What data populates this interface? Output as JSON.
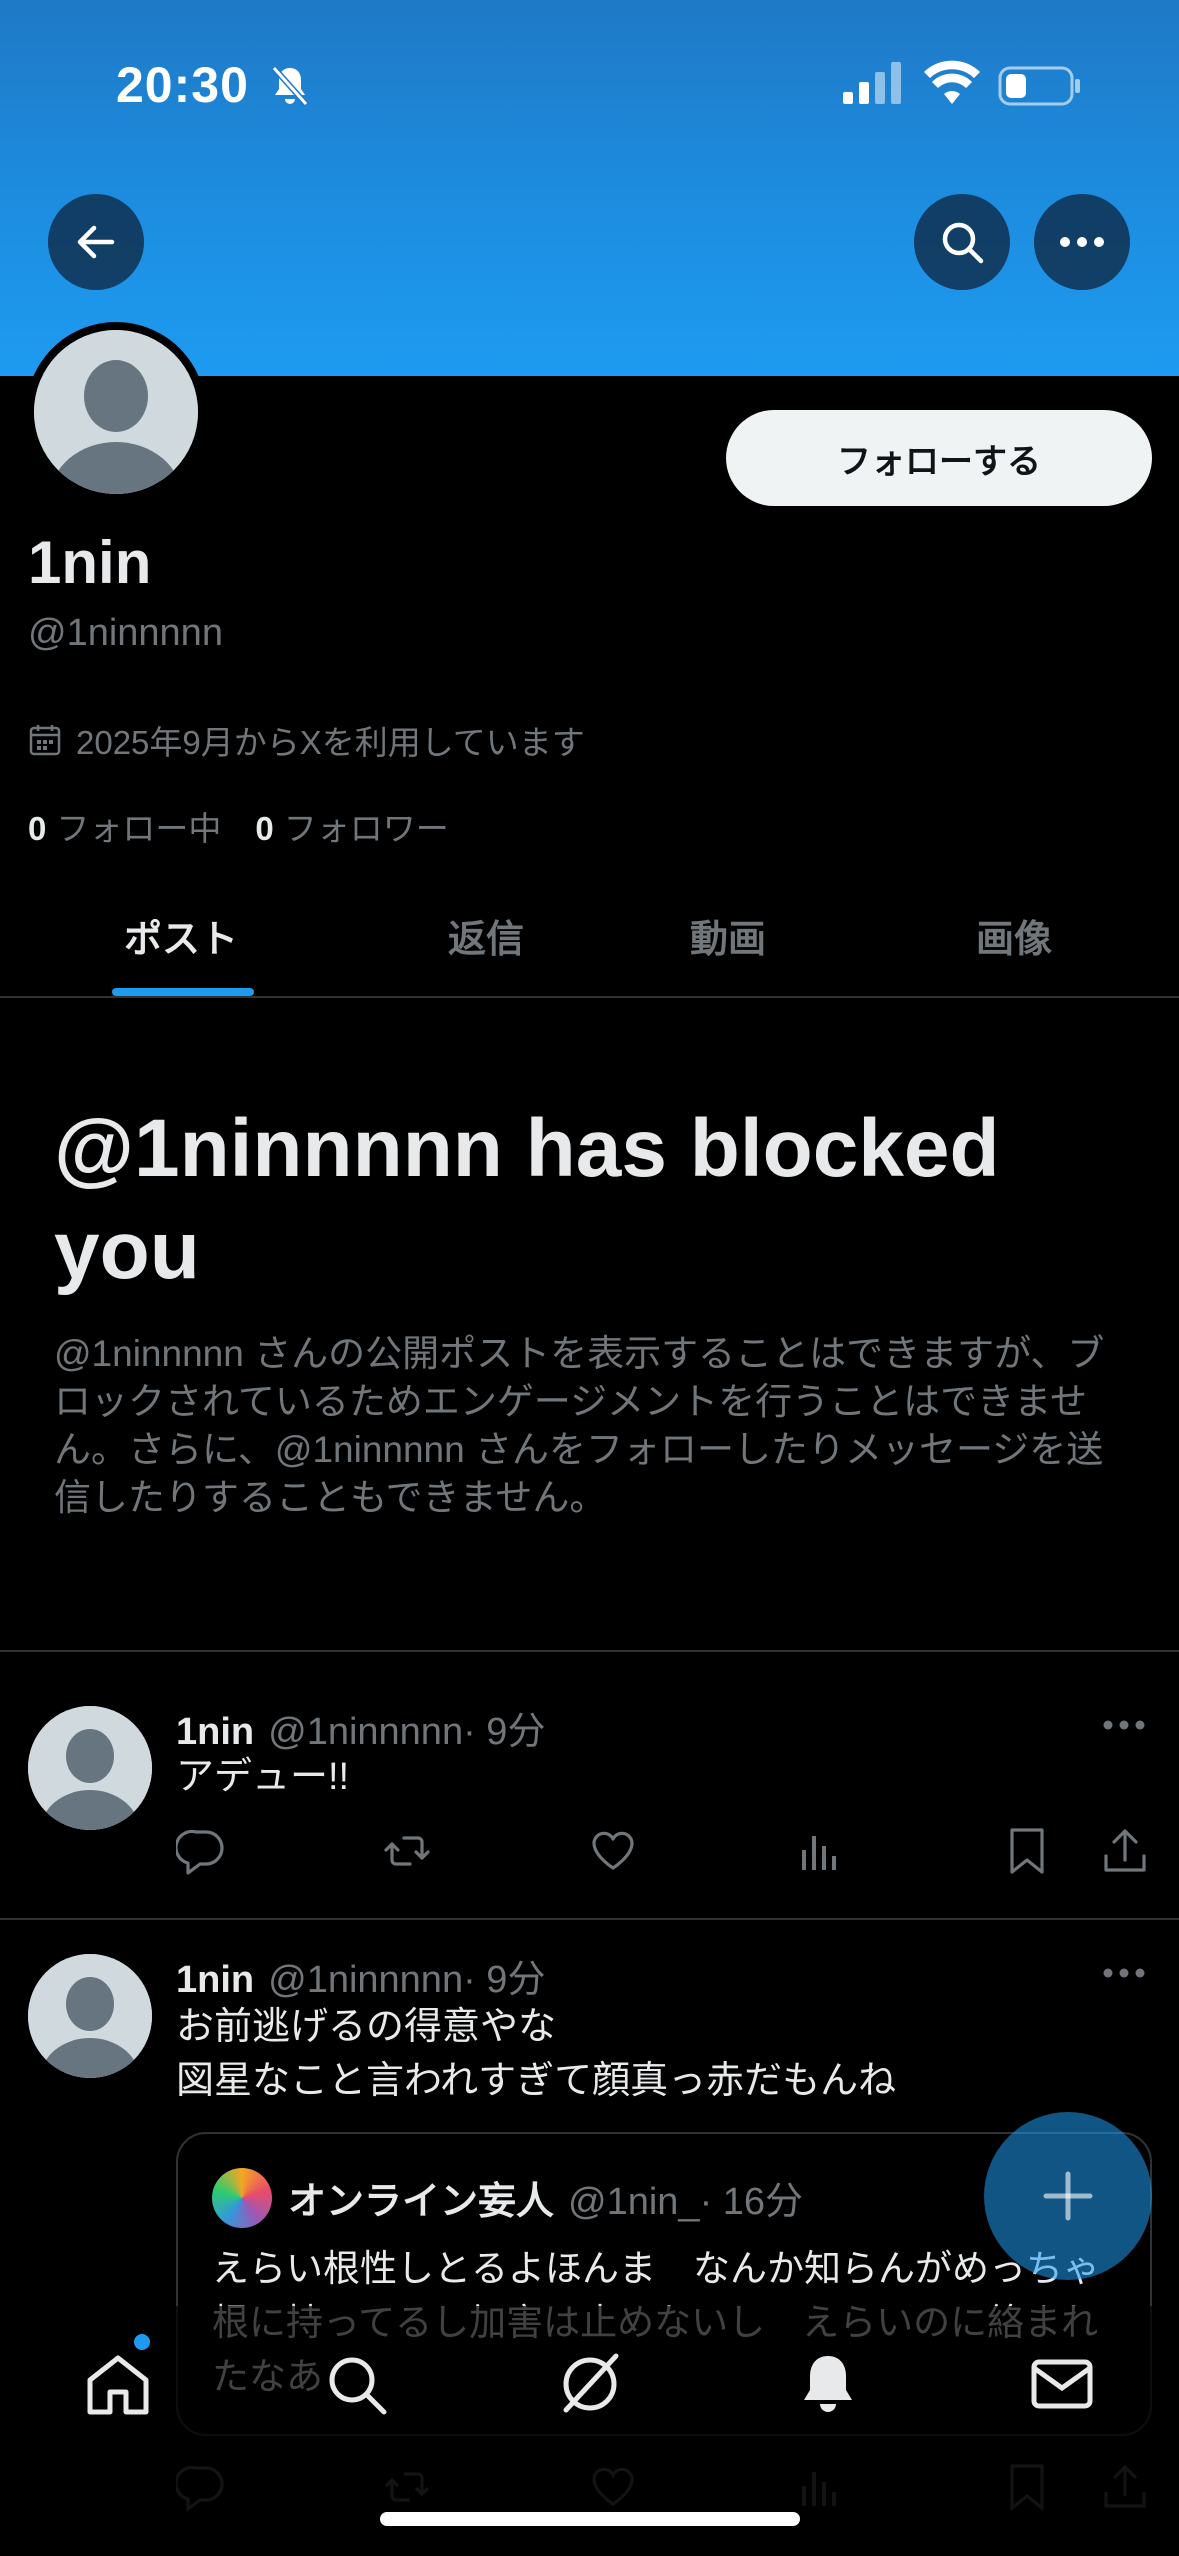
{
  "status_bar": {
    "time": "20:30"
  },
  "profile": {
    "display_name": "1nin",
    "handle": "@1ninnnnn",
    "follow_label": "フォローする",
    "joined": "2025年9月からXを利用しています",
    "following_count": "0",
    "following_label": "フォロー中",
    "followers_count": "0",
    "followers_label": "フォロワー"
  },
  "tabs": [
    {
      "label": "ポスト",
      "active": true
    },
    {
      "label": "返信",
      "active": false
    },
    {
      "label": "動画",
      "active": false
    },
    {
      "label": "画像",
      "active": false
    }
  ],
  "blocked": {
    "title": "@1ninnnnn has blocked you",
    "description": "@1ninnnnn さんの公開ポストを表示することはできますが、ブロックされているためエンゲージメントを行うことはできません。さらに、@1ninnnnn さんをフォローしたりメッセージを送信したりすることもできません。"
  },
  "posts": [
    {
      "name": "1nin",
      "handle": "@1ninnnnn",
      "time": "· 9分",
      "text": "アデュー!!"
    },
    {
      "name": "1nin",
      "handle": "@1ninnnnn",
      "time": "· 9分",
      "text_line1": "お前逃げるの得意やな",
      "text_line2": "図星なこと言われすぎて顔真っ赤だもんね",
      "quote": {
        "name": "オンライン妄人",
        "handle": "@1nin_",
        "time": "· 16分",
        "text": "えらい根性しとるよほんま　なんか知らんがめっちゃ根に持ってるし加害は止めないし　えらいのに絡まれたなあ"
      }
    }
  ],
  "colors": {
    "accent": "#1d9bf0",
    "banner": "#1d8fe2",
    "background": "#000000",
    "text_primary": "#e7e9ea",
    "text_secondary": "#71767b"
  }
}
